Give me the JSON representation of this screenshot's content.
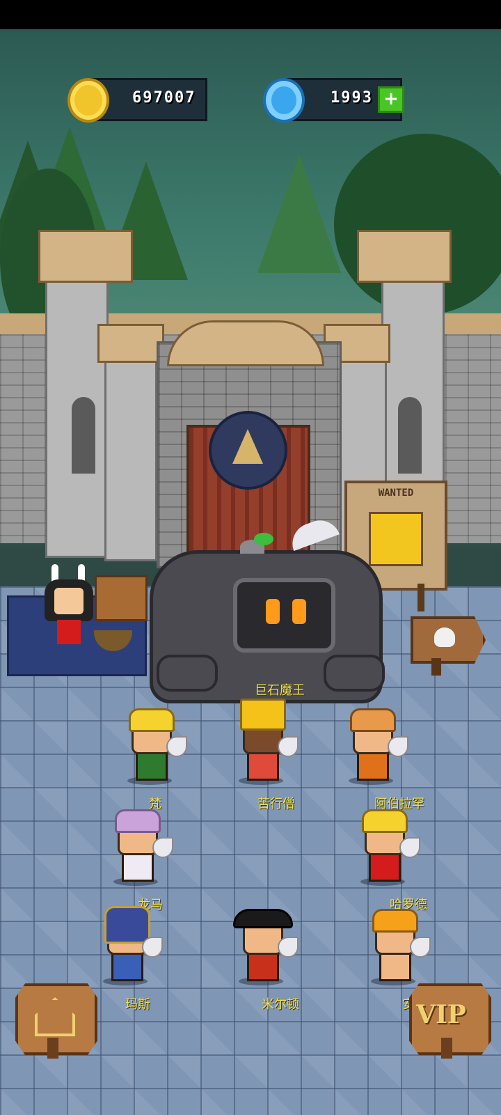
{
  "currency": {
    "coins": "697007",
    "gems": "1993",
    "add_gems_label": "+"
  },
  "boss": {
    "name": "巨石魔王"
  },
  "heroes": [
    {
      "name": "梵"
    },
    {
      "name": "苦行僧"
    },
    {
      "name": "阿伯拉罕"
    },
    {
      "name": "龙马"
    },
    {
      "name": "哈罗德"
    },
    {
      "name": "玛斯"
    },
    {
      "name": "米尔顿"
    },
    {
      "name": "安德烈"
    }
  ],
  "poster": {
    "label": "WANTED"
  },
  "buttons": {
    "vip_label": "VIP"
  },
  "icons": {
    "coin": "gold-coin-icon",
    "gem": "blue-gem-icon",
    "home": "home-icon",
    "skull": "skull-crossbones-icon"
  },
  "colors": {
    "name_text": "#f5e33a",
    "coin": "#f0c52c",
    "gem": "#3aa6ee",
    "plus": "#49c526"
  }
}
